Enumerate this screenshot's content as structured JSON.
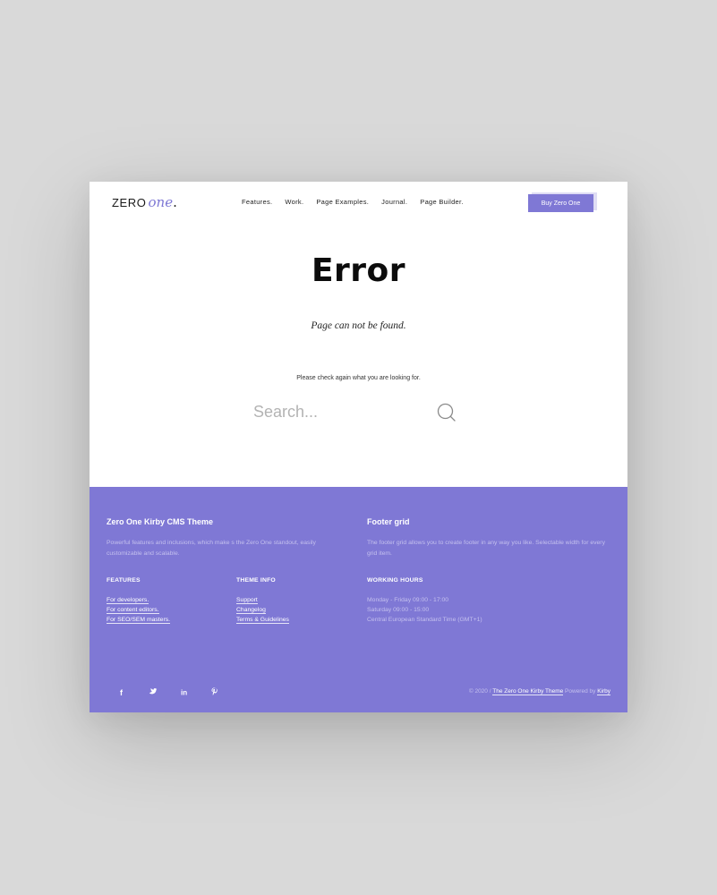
{
  "brand": {
    "logo_zero": "ZERO",
    "logo_one": "one",
    "logo_dot": ".",
    "accent_color": "#7f78d5"
  },
  "header": {
    "nav": [
      {
        "label": "Features."
      },
      {
        "label": "Work."
      },
      {
        "label": "Page Examples."
      },
      {
        "label": "Journal."
      },
      {
        "label": "Page Builder."
      }
    ],
    "buy_label": "Buy Zero One"
  },
  "main": {
    "title": "Error",
    "subtitle": "Page can not be found.",
    "hint": "Please check again what you are looking for.",
    "search": {
      "placeholder": "Search...",
      "icon": "search-icon"
    }
  },
  "footer": {
    "col1": {
      "heading": "Zero One Kirby CMS Theme",
      "description": "Powerful features and inclusions, which make s the Zero One standout, easily customizable and scalable."
    },
    "col2": {
      "heading": "Footer grid",
      "description": "The footer grid allows you to create footer in any way you like. Selectable width for every grid item."
    },
    "features": {
      "heading": "FEATURES",
      "links": [
        "For developers.",
        "For content editors.",
        "For SEO/SEM masters."
      ]
    },
    "theme_info": {
      "heading": "THEME INFO",
      "links": [
        "Support",
        "Changelog",
        "Terms & Guidelines"
      ]
    },
    "working_hours": {
      "heading": "WORKING HOURS",
      "lines": [
        "Monday - Friday 09:00 - 17:00",
        "Saturday 09:00 - 15:00",
        "Central European Standard Time (GMT+1)"
      ]
    },
    "social": [
      {
        "icon": "facebook-icon",
        "label": "f"
      },
      {
        "icon": "twitter-icon"
      },
      {
        "icon": "linkedin-icon",
        "label": "in"
      },
      {
        "icon": "pinterest-icon"
      }
    ],
    "copyright": {
      "prefix": "© 2020 /",
      "theme_link": "The Zero One Kirby Theme",
      "powered_by": "Powered by",
      "kirby_link": "Kirby"
    }
  }
}
